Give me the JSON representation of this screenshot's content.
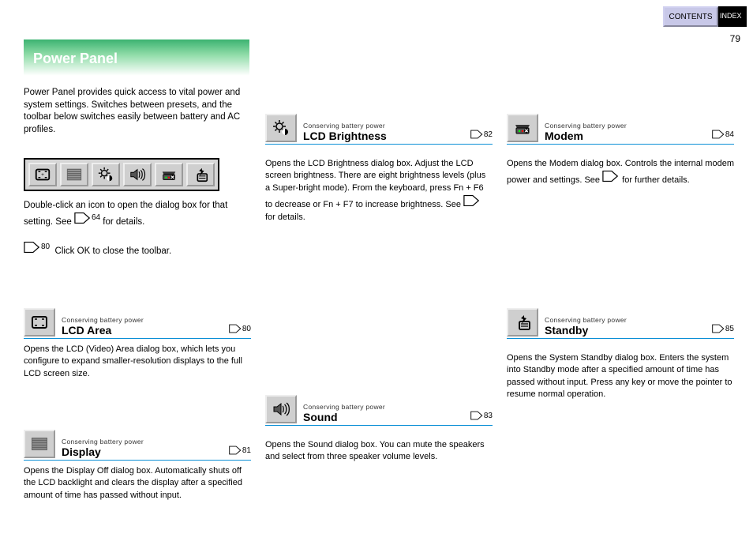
{
  "top": {
    "contents": "    CONTENTS",
    "index": "INDEX"
  },
  "page_number": "79",
  "banner": "Power Panel",
  "intro": "Power Panel provides quick access to vital power and system settings. Switches between presets, and the toolbar below switches easily between battery and AC profiles.",
  "below_toolbar_1": "Double-click an icon to open the dialog box for that setting. See ",
  "below_toolbar_2": " for details.",
  "below_toolbar_3": "Click OK to close the toolbar.",
  "toolbar_icons": {
    "lcd": "lcd-area-icon",
    "display": "display-icon",
    "brightness": "brightness-icon",
    "sound": "sound-icon",
    "modem": "modem-icon",
    "standby": "standby-icon"
  },
  "inline_page_refs": {
    "p64": "64",
    "p80": "80",
    "p81": "81",
    "p82": "82",
    "p83": "83",
    "p84": "84",
    "p85": "85"
  },
  "sections": {
    "lcd": {
      "eyebrow": "Conserving battery power",
      "title": "LCD Area",
      "page": "80",
      "body": "Opens the LCD (Video) Area dialog box, which lets you configure to expand smaller-resolution displays to the full LCD screen size."
    },
    "display": {
      "eyebrow": "Conserving battery power",
      "title": "Display",
      "page": "81",
      "body": "Opens the Display Off dialog box. Automatically shuts off the LCD backlight and clears the display after a specified amount of time has passed without input."
    },
    "brightness": {
      "eyebrow": "Conserving battery power",
      "title": "LCD Brightness",
      "page": "82",
      "body_before": "Opens the LCD Brightness dialog box. Adjust the LCD screen brightness. There are eight brightness levels (plus a Super-bright mode). From the keyboard, press Fn + F6 to decrease or Fn + F7 to increase brightness. See ",
      "body_after": " for details."
    },
    "sound": {
      "eyebrow": "Conserving battery power",
      "title": "Sound",
      "page": "83",
      "body": "Opens the Sound dialog box. You can mute the speakers and select from three speaker volume levels."
    },
    "modem": {
      "eyebrow": "Conserving battery power",
      "title": "Modem",
      "page": "84",
      "body_before": "Opens the Modem dialog box. Controls the internal modem power and settings. See ",
      "body_after": " for further details."
    },
    "standby": {
      "eyebrow": "Conserving battery power",
      "title": "Standby",
      "page": "85",
      "body": "Opens the System Standby dialog box. Enters the system into Standby mode after a specified amount of time has passed without input. Press any key or move the pointer to resume normal operation."
    }
  }
}
